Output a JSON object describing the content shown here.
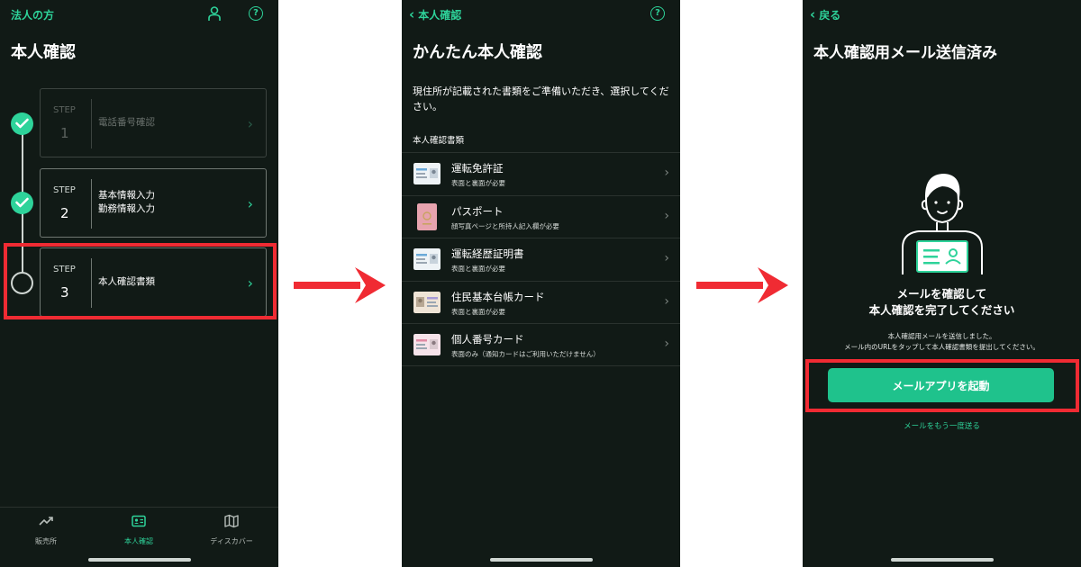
{
  "screen1": {
    "header_label": "法人の方",
    "title": "本人確認",
    "steps": [
      {
        "step_label": "STEP",
        "number": "1",
        "line1": "電話番号確認",
        "line2": "",
        "state": "done-disabled"
      },
      {
        "step_label": "STEP",
        "number": "2",
        "line1": "基本情報入力",
        "line2": "勤務情報入力",
        "state": "done"
      },
      {
        "step_label": "STEP",
        "number": "3",
        "line1": "本人確認書類",
        "line2": "",
        "state": "current"
      }
    ],
    "tabs": [
      {
        "label": "販売所",
        "icon": "trend-icon"
      },
      {
        "label": "本人確認",
        "icon": "id-card-icon"
      },
      {
        "label": "ディスカバー",
        "icon": "map-icon"
      }
    ]
  },
  "screen2": {
    "back_label": "本人確認",
    "title": "かんたん本人確認",
    "description": "現住所が記載された書類をご準備いただき、選択してください。",
    "section_label": "本人確認書類",
    "documents": [
      {
        "name": "運転免許証",
        "sub": "表面と裏面が必要",
        "icon": "license-icon"
      },
      {
        "name": "パスポート",
        "sub": "顔写真ページと所持人記入欄が必要",
        "icon": "passport-icon"
      },
      {
        "name": "運転経歴証明書",
        "sub": "表面と裏面が必要",
        "icon": "driving-history-icon"
      },
      {
        "name": "住民基本台帳カード",
        "sub": "表面と裏面が必要",
        "icon": "resident-card-icon"
      },
      {
        "name": "個人番号カード",
        "sub": "表面のみ（通知カードはご利用いただけません）",
        "icon": "mynumber-card-icon"
      }
    ]
  },
  "screen3": {
    "back_label": "戻る",
    "title": "本人確認用メール送信済み",
    "heading_line1": "メールを確認して",
    "heading_line2": "本人確認を完了してください",
    "info_line1": "本人確認用メールを送信しました。",
    "info_line2": "メール内のURLをタップして本人確認書類を提出してください。",
    "primary_button": "メールアプリを起動",
    "resend_link": "メールをもう一度送る"
  },
  "colors": {
    "accent": "#2ed39a",
    "highlight": "#f02b33",
    "background": "#111a16"
  }
}
